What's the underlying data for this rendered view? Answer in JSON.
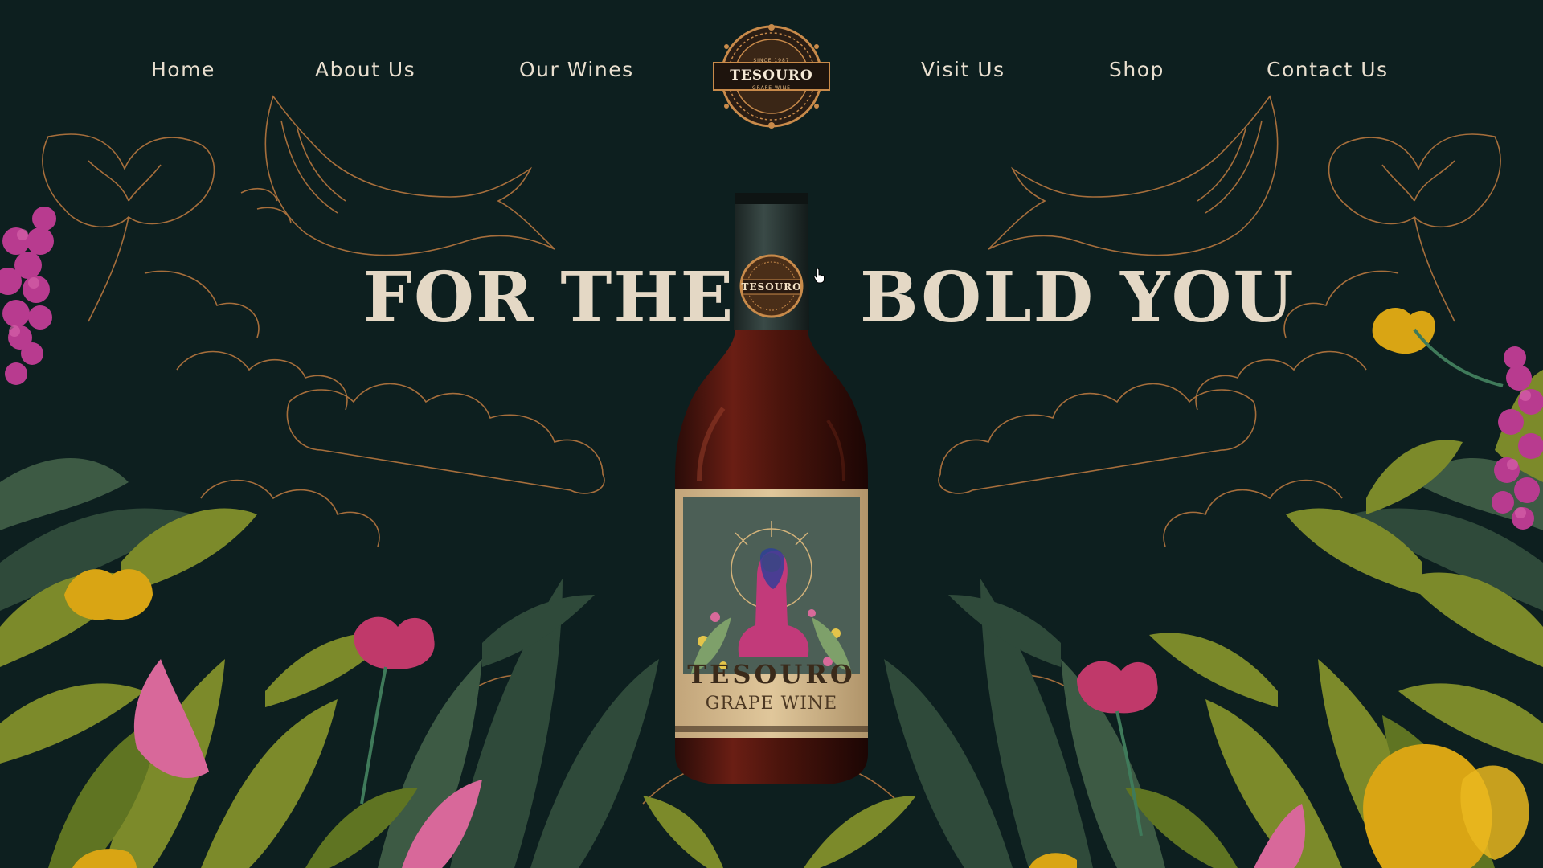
{
  "nav": {
    "left_items": [
      {
        "label": "Home"
      },
      {
        "label": "About Us"
      },
      {
        "label": "Our Wines"
      }
    ],
    "right_items": [
      {
        "label": "Visit Us"
      },
      {
        "label": "Shop"
      },
      {
        "label": "Contact Us"
      }
    ]
  },
  "logo": {
    "brand": "TESOURO",
    "top_text": "SINCE 1987",
    "bottom_text": "GRAPE WINE"
  },
  "hero": {
    "headline_left": "FOR THE",
    "headline_right": "BOLD YOU"
  },
  "bottle": {
    "label_brand": "TESOURO",
    "label_product": "GRAPE WINE",
    "neck_brand": "TESOURO"
  },
  "colors": {
    "background": "#0d1f1f",
    "nav_text": "#e9dfcf",
    "headline": "#e4d8c5",
    "line_art": "#b7773f",
    "leaf_olive": "#7c8a2a",
    "leaf_dark": "#2f4a3a",
    "flower_pink": "#c0396a",
    "flower_yellow": "#d9a514",
    "grape_purple": "#b83b8f"
  },
  "icons": {
    "cursor": "hand-pointer-icon"
  }
}
